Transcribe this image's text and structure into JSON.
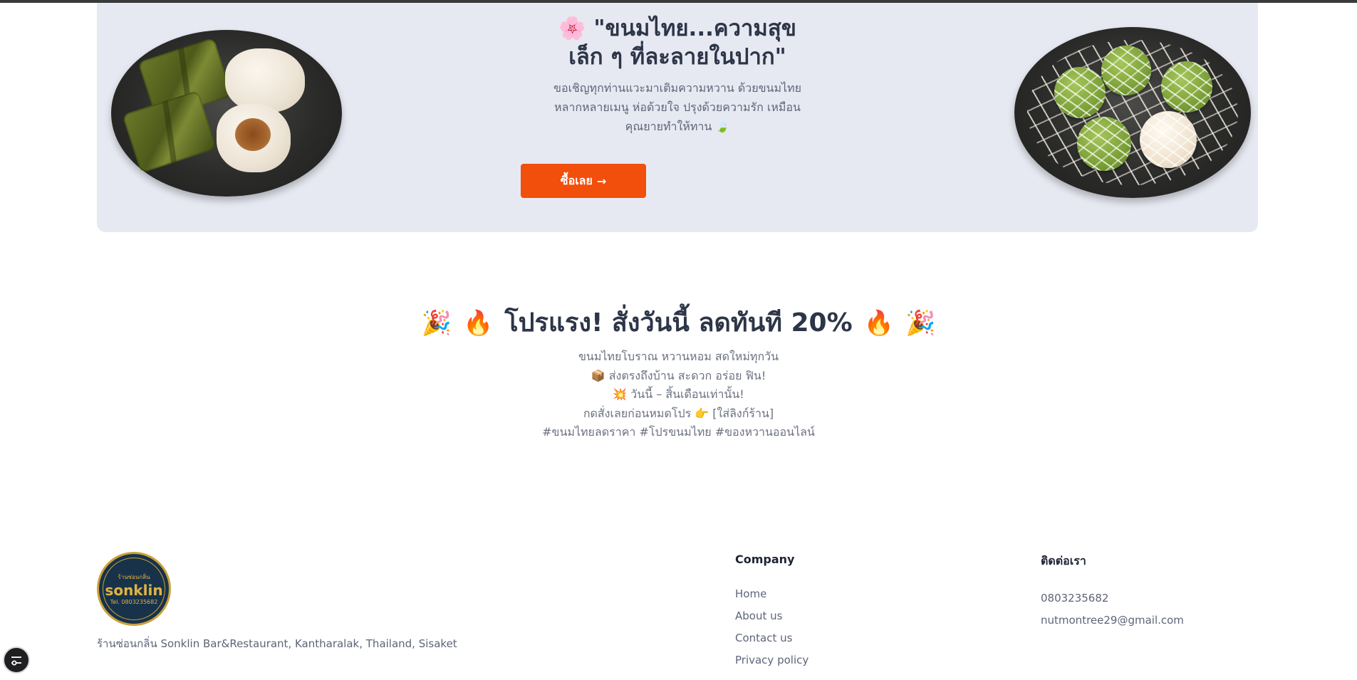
{
  "hero": {
    "title": "🌸 \"ขนมไทย...ความสุขเล็ก ๆ ที่ละลายในปาก\"",
    "description": "ขอเชิญทุกท่านแวะมาเติมความหวาน ด้วยขนมไทยหลากหลายเมนู ห่อด้วยใจ ปรุงด้วยความรัก เหมือนคุณยายทำให้ทาน 🍃",
    "button_label": "ซื้อเลย",
    "button_arrow": "→",
    "accent_color": "#f24e0c",
    "background_color": "#e7e9f2"
  },
  "promo": {
    "title_text": "โปรแรง! สั่งวันนี้ ลดทันที 20%",
    "emoji_party": "🎉",
    "emoji_fire": "🔥",
    "lines": [
      "ขนมไทยโบราณ หวานหอม สดใหม่ทุกวัน",
      "📦 ส่งตรงถึงบ้าน สะดวก อร่อย ฟิน!",
      "💥 วันนี้ – สิ้นเดือนเท่านั้น!",
      "กดสั่งเลยก่อนหมดโปร 👉 [ใส่ลิงก์ร้าน]",
      "#ขนมไทยลดราคา #โปรขนมไทย #ของหวานออนไลน์"
    ]
  },
  "footer": {
    "logo": {
      "word": "sonklin",
      "top_text": "ร้านซ่อนกลิ่น",
      "bottom_text": "Tel. 0803235682"
    },
    "address": "ร้านซ่อนกลิ่น Sonklin Bar&Restaurant, Kantharalak, Thailand, Sisaket",
    "company": {
      "title": "Company",
      "links": [
        "Home",
        "About us",
        "Contact us",
        "Privacy policy"
      ]
    },
    "contact": {
      "title": "ติดต่อเรา",
      "phone": "0803235682",
      "email": "nutmontree29@gmail.com"
    }
  },
  "fab_icon": "settings-sliders-icon"
}
